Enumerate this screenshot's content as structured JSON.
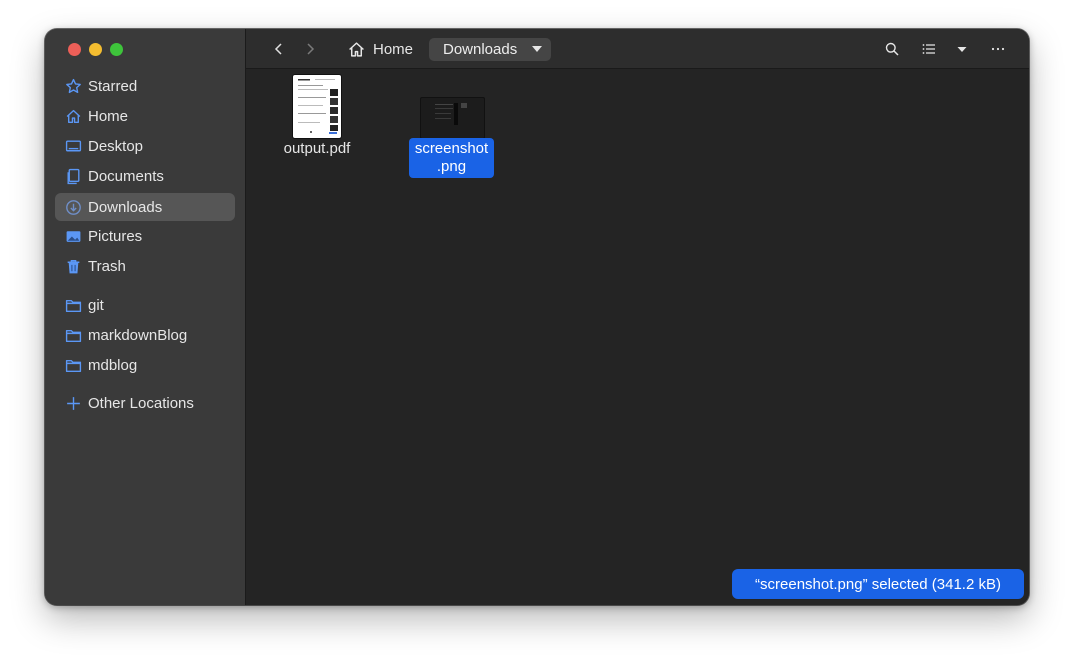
{
  "sidebar": {
    "items": [
      {
        "label": "Starred",
        "icon": "star-icon"
      },
      {
        "label": "Home",
        "icon": "home-icon"
      },
      {
        "label": "Desktop",
        "icon": "desktop-icon"
      },
      {
        "label": "Documents",
        "icon": "documents-icon"
      },
      {
        "label": "Downloads",
        "icon": "download-icon",
        "active": true
      },
      {
        "label": "Pictures",
        "icon": "pictures-icon"
      },
      {
        "label": "Trash",
        "icon": "trash-icon"
      }
    ],
    "bookmarks": [
      {
        "label": "git",
        "icon": "folder-icon"
      },
      {
        "label": "markdownBlog",
        "icon": "folder-icon"
      },
      {
        "label": "mdblog",
        "icon": "folder-icon"
      }
    ],
    "other": {
      "label": "Other Locations",
      "icon": "plus-icon"
    }
  },
  "header": {
    "breadcrumb_home": "Home",
    "breadcrumb_current": "Downloads"
  },
  "files": [
    {
      "name": "output.pdf",
      "icon": "pdf-thumbnail"
    },
    {
      "name_line1": "screenshot",
      "name_line2": ".png",
      "icon": "png-thumbnail",
      "selected": true
    }
  ],
  "status": "“screenshot.png” selected  (341.2 kB)",
  "colors": {
    "accent": "#1a63e6",
    "sidebar": "#3a3a3a",
    "content": "#242424"
  }
}
